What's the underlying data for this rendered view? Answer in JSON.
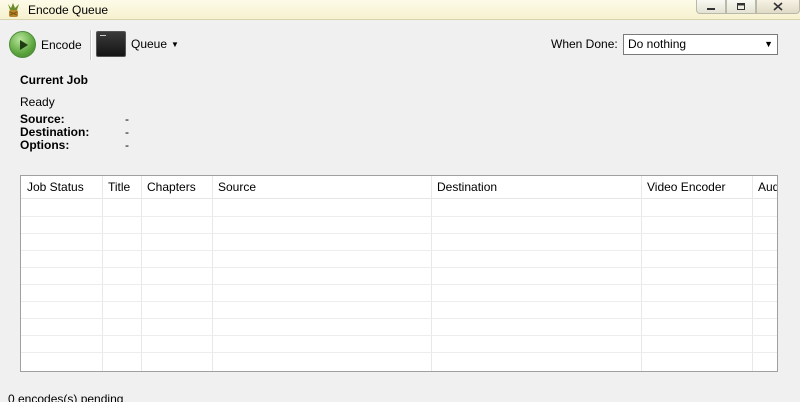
{
  "window": {
    "title": "Encode Queue"
  },
  "toolbar": {
    "encode_label": "Encode",
    "queue_label": "Queue",
    "when_done_label": "When Done:",
    "when_done_value": "Do nothing"
  },
  "current_job": {
    "heading": "Current Job",
    "status": "Ready",
    "source_label": "Source:",
    "source_value": "-",
    "destination_label": "Destination:",
    "destination_value": "-",
    "options_label": "Options:",
    "options_value": "-"
  },
  "table": {
    "columns": [
      "Job Status",
      "Title",
      "Chapters",
      "Source",
      "Destination",
      "Video Encoder",
      "Audio"
    ],
    "rows": []
  },
  "status_bar": {
    "text": "0 encodes(s) pending"
  },
  "colors": {
    "play_green": "#5da63e",
    "title_bar": "#fdfbe8"
  }
}
